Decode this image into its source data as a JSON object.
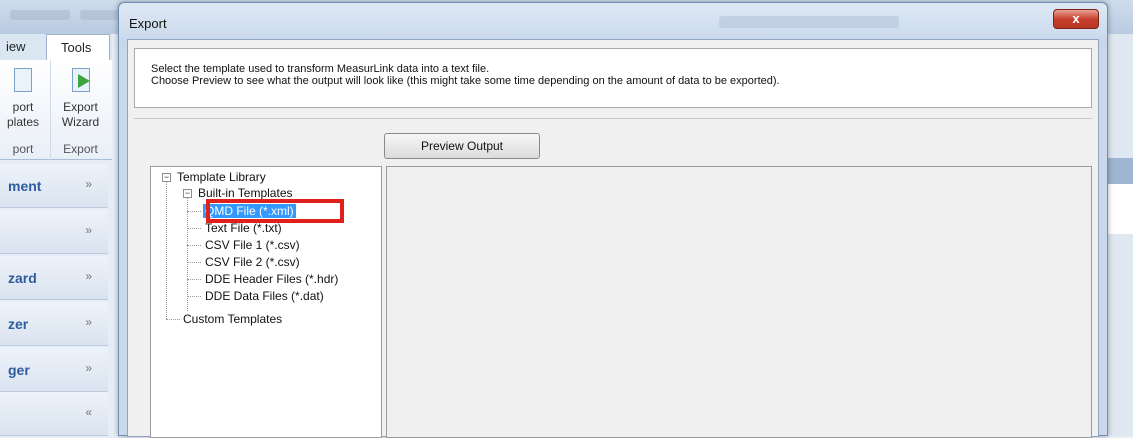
{
  "background_app": {
    "tabs": [
      {
        "label": "iew"
      },
      {
        "label": "Tools"
      }
    ],
    "ribbon": {
      "group1": {
        "label_line1": "port",
        "label_line2": "plates",
        "footer": "port"
      },
      "group2": {
        "label_line1": "Export",
        "label_line2": "Wizard",
        "footer": "Export"
      }
    },
    "nav_items": [
      {
        "label": "ment",
        "chevron": "»"
      },
      {
        "label": "",
        "chevron": "»"
      },
      {
        "label": "zard",
        "chevron": "»"
      },
      {
        "label": "zer",
        "chevron": "»"
      },
      {
        "label": "ger",
        "chevron": "»"
      },
      {
        "label": "",
        "chevron": "«"
      }
    ]
  },
  "dialog": {
    "title": "Export",
    "close_label": "x",
    "instructions": {
      "line1": "Select the template used to transform MeasurLink data into a text file.",
      "line2": "Choose Preview to see what the output will look like (this might take some time depending on the amount of data to be exported)."
    },
    "preview_button": "Preview Output",
    "tree": {
      "root": "Template Library",
      "builtin": "Built-in Templates",
      "items": [
        "QMD File (*.xml)",
        "Text File (*.txt)",
        "CSV File 1 (*.csv)",
        "CSV File 2 (*.csv)",
        "DDE Header Files (*.hdr)",
        "DDE Data Files (*.dat)"
      ],
      "custom": "Custom Templates",
      "expander_minus": "−"
    }
  },
  "colors": {
    "selection": "#3399ff",
    "highlight": "#e0201b",
    "nav_text": "#2f5c9e"
  },
  "icons": {
    "export_templates": "export-templates-icon",
    "export_wizard": "export-wizard-icon",
    "close": "close-icon",
    "chevron": "chevron-icon"
  }
}
